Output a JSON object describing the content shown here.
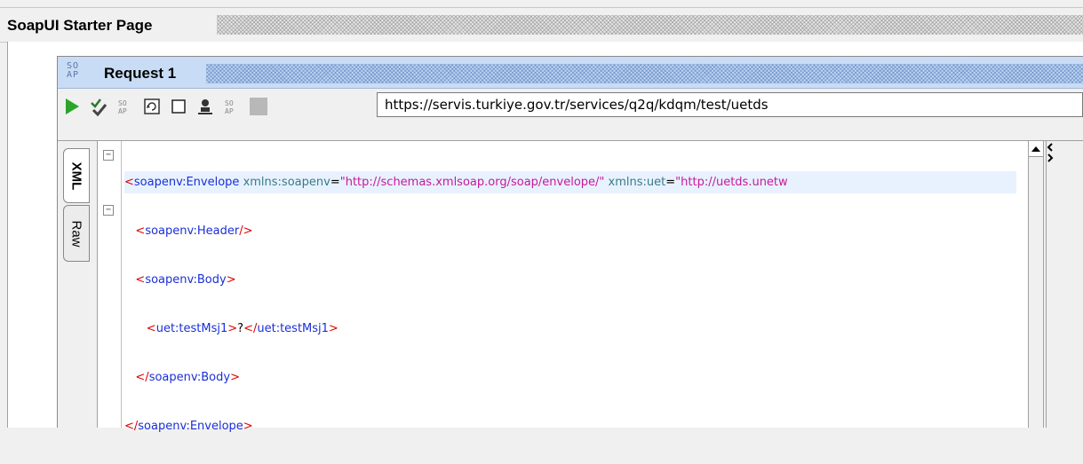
{
  "starter_page": {
    "title": "SoapUI Starter Page"
  },
  "request": {
    "badge": "SO AP",
    "title": "Request 1",
    "endpoint": "https://servis.turkiye.gov.tr/services/q2q/kdqm/test/uetds"
  },
  "editor_tabs": [
    {
      "label": "XML",
      "active": true
    },
    {
      "label": "Raw",
      "active": false
    }
  ],
  "xml": {
    "line1": {
      "open": "<",
      "tag": "soapenv:Envelope",
      "attr1": "xmlns:soapenv",
      "eq1": "=",
      "val1": "\"http://schemas.xmlsoap.org/soap/envelope/\"",
      "attr2": "xmlns:uet",
      "eq2": "=",
      "val2": "\"http://uetds.unetw"
    },
    "line2": {
      "open": "<",
      "tag": "soapenv:Header",
      "close": "/>"
    },
    "line3": {
      "open": "<",
      "tag": "soapenv:Body",
      "close": ">"
    },
    "line4": {
      "open": "<",
      "tag": "uet:testMsj1",
      "close": ">",
      "text": "?",
      "endopen": "</",
      "endtag": "uet:testMsj1",
      "endclose": ">"
    },
    "line5": {
      "open": "</",
      "tag": "soapenv:Body",
      "close": ">"
    },
    "line6": {
      "open": "</",
      "tag": "soapenv:Envelope",
      "close": ">"
    }
  },
  "colors": {
    "tag": "#1b2fd6",
    "bracket": "#e00000",
    "attribute": "#3a7a8a",
    "value": "#c8189c",
    "titlebar_active": "#c9dcf5",
    "run_icon": "#2aa52a"
  },
  "icons": [
    "run-icon",
    "validate-icon",
    "soap-icon",
    "refresh-icon",
    "checkbox-icon",
    "user-icon",
    "soap-icon",
    "stop-icon"
  ]
}
